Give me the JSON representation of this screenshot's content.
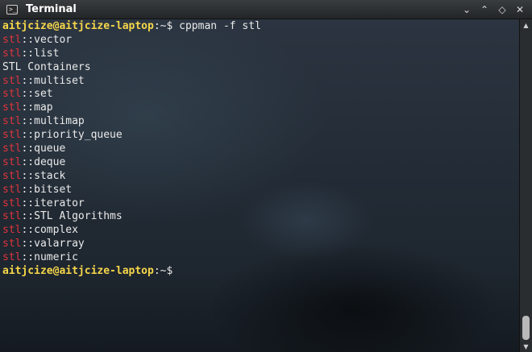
{
  "window": {
    "title": "Terminal",
    "app_icon_glyph": ">_",
    "controls": {
      "menu": "⌄",
      "minimize": "⌃",
      "maximize": "◇",
      "close": "✕"
    }
  },
  "terminal": {
    "command_prompt": {
      "user_host": "aitjcize@aitjcize-laptop",
      "path": ":~$",
      "command": " cppman -f stl"
    },
    "results": [
      {
        "prefix": "stl",
        "sep": "::",
        "name": "vector"
      },
      {
        "prefix": "stl",
        "sep": "::",
        "name": "list"
      },
      {
        "prefix": "",
        "sep": "",
        "name": "STL Containers"
      },
      {
        "prefix": "stl",
        "sep": "::",
        "name": "multiset"
      },
      {
        "prefix": "stl",
        "sep": "::",
        "name": "set"
      },
      {
        "prefix": "stl",
        "sep": "::",
        "name": "map"
      },
      {
        "prefix": "stl",
        "sep": "::",
        "name": "multimap"
      },
      {
        "prefix": "stl",
        "sep": "::",
        "name": "priority_queue"
      },
      {
        "prefix": "stl",
        "sep": "::",
        "name": "queue"
      },
      {
        "prefix": "stl",
        "sep": "::",
        "name": "deque"
      },
      {
        "prefix": "stl",
        "sep": "::",
        "name": "stack"
      },
      {
        "prefix": "stl",
        "sep": "::",
        "name": "bitset"
      },
      {
        "prefix": "stl",
        "sep": "::",
        "name": "iterator"
      },
      {
        "prefix": "stl",
        "sep": "::",
        "name": "STL Algorithms"
      },
      {
        "prefix": "stl",
        "sep": "::",
        "name": "complex"
      },
      {
        "prefix": "stl",
        "sep": "::",
        "name": "valarray"
      },
      {
        "prefix": "stl",
        "sep": "::",
        "name": "numeric"
      }
    ],
    "final_prompt": {
      "user_host": "aitjcize@aitjcize-laptop",
      "path": ":~$"
    }
  },
  "scrollbar": {
    "up_arrow": "▲",
    "down_arrow": "▼"
  },
  "colors": {
    "prompt": "#f6d64a",
    "keyword": "#e0343c",
    "text": "#eaeaea"
  }
}
